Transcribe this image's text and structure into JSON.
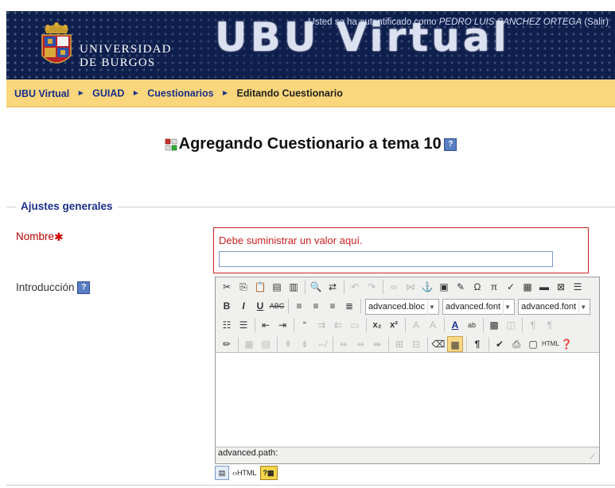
{
  "header": {
    "university_line1": "UNIVERSIDAD",
    "university_line2": "DE BURGOS",
    "site_title": "UBU Virtual",
    "login_prefix": "Usted se ha autentificado como",
    "login_user": "PEDRO LUIS SANCHEZ ORTEGA",
    "logout_label": "(Salir)"
  },
  "breadcrumb": {
    "items": [
      "UBU Virtual",
      "GUIAD",
      "Cuestionarios"
    ],
    "separator": "►",
    "current": "Editando Cuestionario"
  },
  "page": {
    "heading": "Agregando Cuestionario a tema 10"
  },
  "section": {
    "legend": "Ajustes generales"
  },
  "form": {
    "name_label": "Nombre",
    "name_required": "✱",
    "name_error": "Debe suministrar un valor aquí.",
    "name_value": "",
    "intro_label": "Introducción"
  },
  "editor": {
    "block_format": "advanced.bloc",
    "font_family": "advanced.font",
    "font_size": "advanced.font",
    "path_label": "advanced.path:",
    "html_mode_label": "HTML"
  },
  "colors": {
    "banner_bg": "#0f1f4d",
    "breadcrumb_bg": "#fad77c",
    "link": "#1a2f8a",
    "error": "#cc2222"
  }
}
